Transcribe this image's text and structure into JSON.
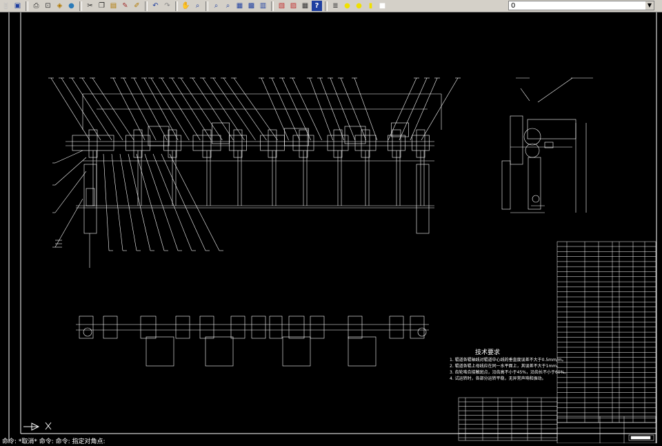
{
  "toolbar": {
    "layer_value": "0",
    "buttons": [
      {
        "name": "new-icon",
        "glyph": "▯",
        "color": "#ffffff"
      },
      {
        "name": "save-icon",
        "glyph": "▣",
        "color": "#1f3fa0"
      },
      {
        "name": "print-icon",
        "glyph": "⎙",
        "color": "#333333"
      },
      {
        "name": "print-preview-icon",
        "glyph": "⊡",
        "color": "#333333"
      },
      {
        "name": "publish-icon",
        "glyph": "◈",
        "color": "#b07800"
      },
      {
        "name": "globe-icon",
        "glyph": "●",
        "color": "#2a7ab8"
      },
      {
        "name": "cut-icon",
        "glyph": "✂",
        "color": "#222222"
      },
      {
        "name": "copy-icon",
        "glyph": "❐",
        "color": "#222222"
      },
      {
        "name": "paste-icon",
        "glyph": "▤",
        "color": "#b07800"
      },
      {
        "name": "match-properties-icon",
        "glyph": "✎",
        "color": "#a03030"
      },
      {
        "name": "block-editor-icon",
        "glyph": "✐",
        "color": "#b07800"
      },
      {
        "name": "undo-icon",
        "glyph": "↶",
        "color": "#1f3fa0"
      },
      {
        "name": "redo-icon",
        "glyph": "↷",
        "color": "#888888"
      },
      {
        "name": "pan-icon",
        "glyph": "✋",
        "color": "#b07800"
      },
      {
        "name": "zoom-realtime-icon",
        "glyph": "⌕",
        "color": "#1f3fa0"
      },
      {
        "name": "zoom-window-icon",
        "glyph": "⌕",
        "color": "#1f3fa0"
      },
      {
        "name": "zoom-previous-icon",
        "glyph": "⌕",
        "color": "#1f3fa0"
      },
      {
        "name": "properties-icon",
        "glyph": "▦",
        "color": "#1f3fa0"
      },
      {
        "name": "design-center-icon",
        "glyph": "▩",
        "color": "#1f3fa0"
      },
      {
        "name": "tool-palettes-icon",
        "glyph": "▥",
        "color": "#1f3fa0"
      },
      {
        "name": "sheet-set-icon",
        "glyph": "▧",
        "color": "#c03030"
      },
      {
        "name": "markup-icon",
        "glyph": "▨",
        "color": "#c03030"
      },
      {
        "name": "calculator-icon",
        "glyph": "▦",
        "color": "#333333"
      },
      {
        "name": "help-icon",
        "glyph": "?",
        "color": "#ffffff"
      }
    ],
    "layer_icons": [
      {
        "name": "layers-icon",
        "glyph": "≣",
        "color": "#333333"
      },
      {
        "name": "lightbulb-icon",
        "glyph": "●",
        "color": "#f0e000"
      },
      {
        "name": "sun-icon",
        "glyph": "●",
        "color": "#f0e000"
      },
      {
        "name": "lock-icon",
        "glyph": "▮",
        "color": "#f0e000"
      },
      {
        "name": "color-swatch-icon",
        "glyph": "■",
        "color": "#ffffff"
      }
    ]
  },
  "drawing": {
    "tech_title": "技术要求",
    "notes": [
      "1. 辊道各辊轴线对辊道中心线的垂直度误差不大于0.5mm/m。",
      "2. 辊道各辊上母线应在同一水平面上，其误差不大于1mm。",
      "3. 齿轮啮合接触斑点，沿齿高不小于45%，沿齿长不小于60%。",
      "4. 试运转时，各部分运转平稳，无异常声响和振动。"
    ],
    "command_line": "命令: *取消*  命令: 命令: 指定对角点:"
  },
  "colors": {
    "canvas": "#000000",
    "lines": "#ffffff",
    "toolbar": "#d4d0c8"
  }
}
